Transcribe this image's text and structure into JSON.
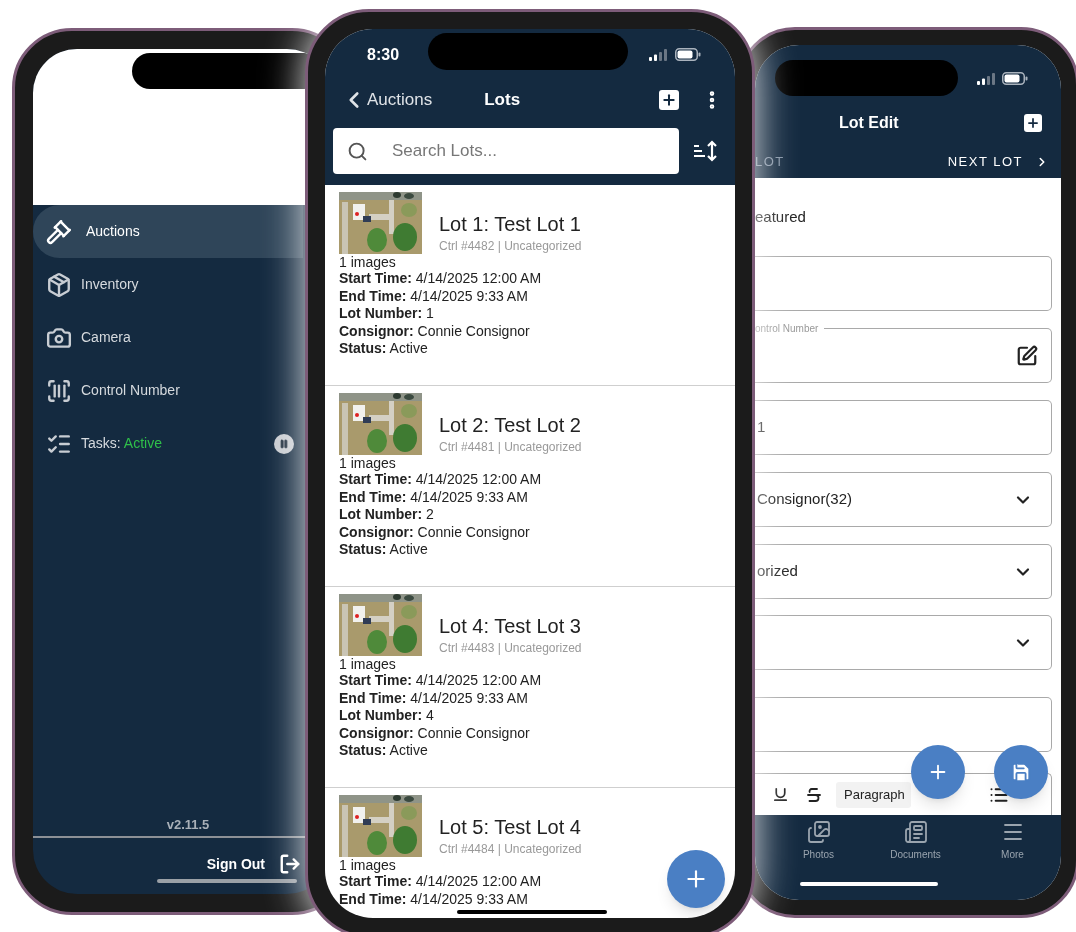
{
  "menu_phone": {
    "menu": [
      {
        "kind": "link",
        "label": "Auctions",
        "selected": true
      },
      {
        "kind": "link",
        "label": "Inventory",
        "selected": false
      },
      {
        "kind": "link",
        "label": "Camera",
        "selected": false
      },
      {
        "kind": "link",
        "label": "Control Number",
        "selected": false
      },
      {
        "kind": "tasks",
        "label": "Tasks:",
        "status": "Active",
        "selected": false
      }
    ],
    "version": "v2.11.5",
    "sign_out": "Sign Out"
  },
  "lots_phone": {
    "time": "8:30",
    "back": "Auctions",
    "title": "Lots",
    "search_placeholder": "Search Lots...",
    "lots": [
      {
        "title": "Lot 1: Test Lot 1",
        "meta": "Ctrl #4482 | Uncategorized",
        "images": "1 images",
        "fields": [
          {
            "label": "Start Time:",
            "value": "4/14/2025 12:00 AM"
          },
          {
            "label": "End Time:",
            "value": "4/14/2025 9:33 AM"
          },
          {
            "label": "Lot Number:",
            "value": "1"
          },
          {
            "label": "Consignor:",
            "value": "Connie Consignor"
          },
          {
            "label": "Status:",
            "value": "Active"
          }
        ]
      },
      {
        "title": "Lot 2: Test Lot 2",
        "meta": "Ctrl #4481 | Uncategorized",
        "images": "1 images",
        "fields": [
          {
            "label": "Start Time:",
            "value": "4/14/2025 12:00 AM"
          },
          {
            "label": "End Time:",
            "value": "4/14/2025 9:33 AM"
          },
          {
            "label": "Lot Number:",
            "value": "2"
          },
          {
            "label": "Consignor:",
            "value": "Connie Consignor"
          },
          {
            "label": "Status:",
            "value": "Active"
          }
        ]
      },
      {
        "title": "Lot 4: Test Lot 3",
        "meta": "Ctrl #4483 | Uncategorized",
        "images": "1 images",
        "fields": [
          {
            "label": "Start Time:",
            "value": "4/14/2025 12:00 AM"
          },
          {
            "label": "End Time:",
            "value": "4/14/2025 9:33 AM"
          },
          {
            "label": "Lot Number:",
            "value": "4"
          },
          {
            "label": "Consignor:",
            "value": "Connie Consignor"
          },
          {
            "label": "Status:",
            "value": "Active"
          }
        ]
      },
      {
        "title": "Lot 5: Test Lot 4",
        "meta": "Ctrl #4484 | Uncategorized",
        "images": "1 images",
        "fields": [
          {
            "label": "Start Time:",
            "value": "4/14/2025 12:00 AM"
          },
          {
            "label": "End Time:",
            "value": "4/14/2025 9:33 AM"
          }
        ]
      }
    ]
  },
  "edit_phone": {
    "title": "Lot Edit",
    "prev": "LOT",
    "next": "NEXT LOT",
    "featured": "eatured",
    "fields": [
      {
        "kind": "text"
      },
      {
        "kind": "control",
        "label": "ontrol Number"
      },
      {
        "kind": "text",
        "value": "1"
      },
      {
        "kind": "select",
        "value": "Consignor(32)"
      },
      {
        "kind": "select",
        "value": "orized"
      },
      {
        "kind": "select"
      },
      {
        "kind": "text"
      }
    ],
    "editor": {
      "format": "Paragraph"
    },
    "tabs": [
      {
        "label": "Photos"
      },
      {
        "label": "Documents"
      },
      {
        "label": "More"
      }
    ]
  }
}
